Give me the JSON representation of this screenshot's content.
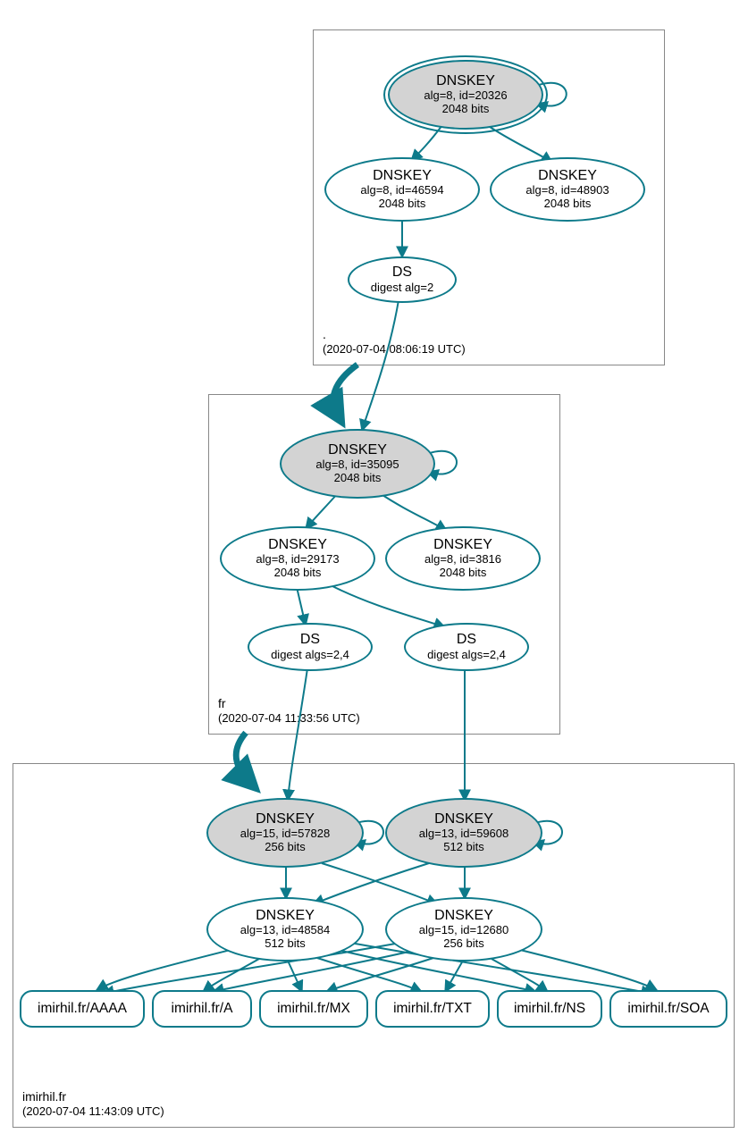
{
  "colors": {
    "stroke": "#0d7a8a",
    "node_fill_grey": "#d3d3d3",
    "zone_border": "#888888"
  },
  "zones": {
    "root": {
      "name": ".",
      "timestamp": "(2020-07-04 08:06:19 UTC)"
    },
    "fr": {
      "name": "fr",
      "timestamp": "(2020-07-04 11:33:56 UTC)"
    },
    "imirhil": {
      "name": "imirhil.fr",
      "timestamp": "(2020-07-04 11:43:09 UTC)"
    }
  },
  "nodes": {
    "root_ksk": {
      "title": "DNSKEY",
      "line2": "alg=8, id=20326",
      "line3": "2048 bits"
    },
    "root_zsk1": {
      "title": "DNSKEY",
      "line2": "alg=8, id=46594",
      "line3": "2048 bits"
    },
    "root_zsk2": {
      "title": "DNSKEY",
      "line2": "alg=8, id=48903",
      "line3": "2048 bits"
    },
    "root_ds": {
      "title": "DS",
      "line2": "digest alg=2"
    },
    "fr_ksk": {
      "title": "DNSKEY",
      "line2": "alg=8, id=35095",
      "line3": "2048 bits"
    },
    "fr_zsk1": {
      "title": "DNSKEY",
      "line2": "alg=8, id=29173",
      "line3": "2048 bits"
    },
    "fr_zsk2": {
      "title": "DNSKEY",
      "line2": "alg=8, id=3816",
      "line3": "2048 bits"
    },
    "fr_ds1": {
      "title": "DS",
      "line2": "digest algs=2,4"
    },
    "fr_ds2": {
      "title": "DS",
      "line2": "digest algs=2,4"
    },
    "im_ksk1": {
      "title": "DNSKEY",
      "line2": "alg=15, id=57828",
      "line3": "256 bits"
    },
    "im_ksk2": {
      "title": "DNSKEY",
      "line2": "alg=13, id=59608",
      "line3": "512 bits"
    },
    "im_zsk1": {
      "title": "DNSKEY",
      "line2": "alg=13, id=48584",
      "line3": "512 bits"
    },
    "im_zsk2": {
      "title": "DNSKEY",
      "line2": "alg=15, id=12680",
      "line3": "256 bits"
    }
  },
  "rrsets": {
    "aaaa": "imirhil.fr/AAAA",
    "a": "imirhil.fr/A",
    "mx": "imirhil.fr/MX",
    "txt": "imirhil.fr/TXT",
    "ns": "imirhil.fr/NS",
    "soa": "imirhil.fr/SOA"
  }
}
